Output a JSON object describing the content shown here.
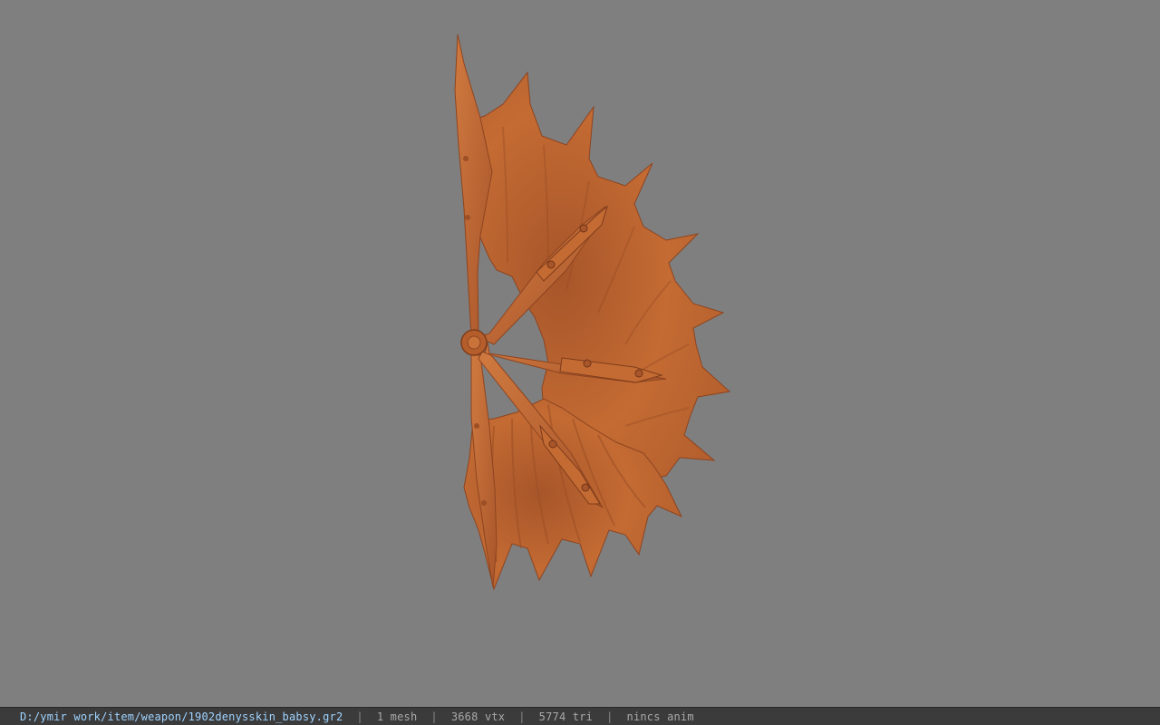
{
  "viewer": {
    "background_color": "#7f7f7f",
    "model_color": "#c0662f",
    "model_name": "weapon-fan-model"
  },
  "status": {
    "file_path": "D:/ymir work/item/weapon/1902denysskin_babsy.gr2",
    "separator": "|",
    "mesh_count": "1 mesh",
    "vertex_count": "3668 vtx",
    "triangle_count": "5774 tri",
    "anim_status": "nincs anim"
  }
}
